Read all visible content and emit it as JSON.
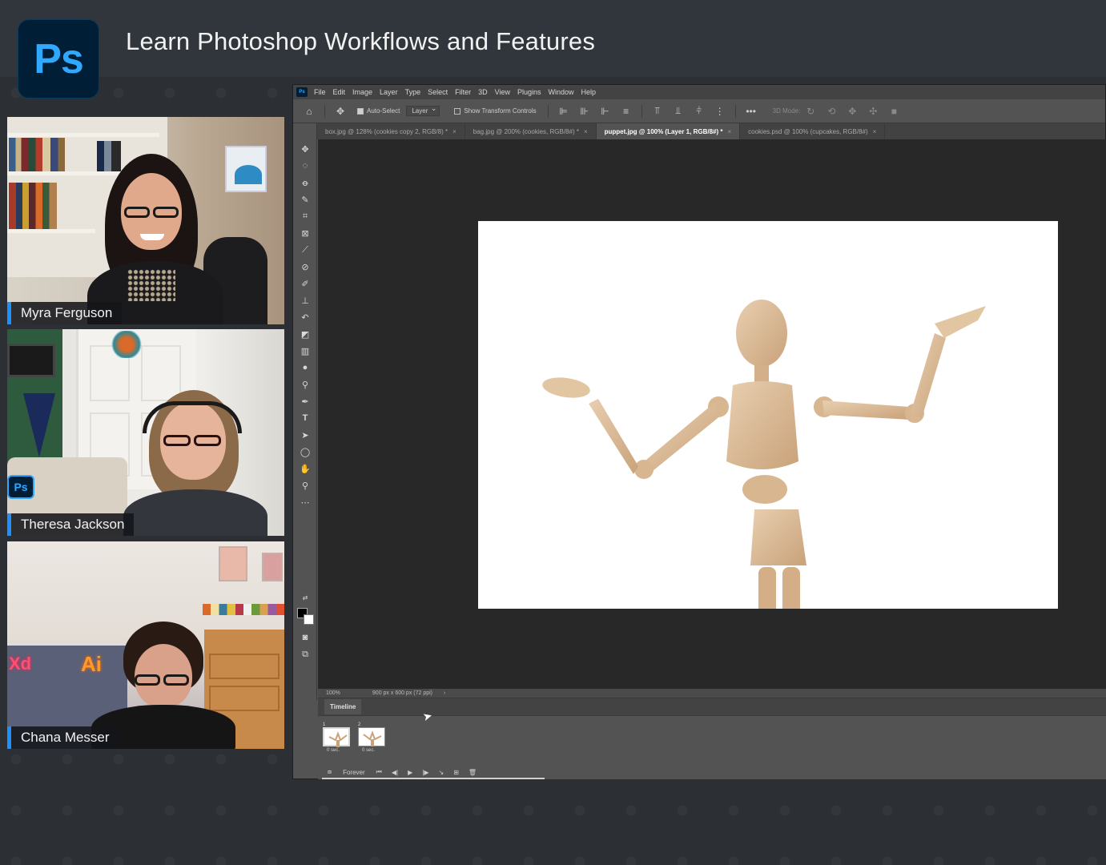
{
  "header": {
    "logo_text": "Ps",
    "title": "Learn Photoshop Workflows and Features"
  },
  "participants": [
    {
      "name": "Myra Ferguson"
    },
    {
      "name": "Theresa Jackson"
    },
    {
      "name": "Chana Messer"
    }
  ],
  "photoshop": {
    "menu": [
      "File",
      "Edit",
      "Image",
      "Layer",
      "Type",
      "Select",
      "Filter",
      "3D",
      "View",
      "Plugins",
      "Window",
      "Help"
    ],
    "options": {
      "auto_select_label": "Auto-Select",
      "auto_select_value": "Layer",
      "show_transform_label": "Show Transform Controls",
      "mode_3d_label": "3D Mode:"
    },
    "tabs": [
      {
        "label": "box.jpg @ 128% (cookies copy 2, RGB/8) *",
        "active": false
      },
      {
        "label": "bag.jpg @ 200% (cookies, RGB/8#) *",
        "active": false
      },
      {
        "label": "puppet.jpg @ 100% (Layer 1, RGB/8#) *",
        "active": true
      },
      {
        "label": "cookies.psd @ 100% (cupcakes, RGB/8#)",
        "active": false
      }
    ],
    "status": {
      "zoom": "100%",
      "doc_info": "900 px x 600 px (72 ppi)"
    },
    "timeline": {
      "panel_title": "Timeline",
      "frames": [
        {
          "num": "1",
          "delay": "0 sec."
        },
        {
          "num": "2",
          "delay": "0 sec."
        }
      ],
      "loop": "Forever"
    }
  },
  "colors": {
    "accent_blue": "#1e90ff",
    "ps_brand_blue": "#31a8ff",
    "ps_brand_bg": "#001e36"
  }
}
